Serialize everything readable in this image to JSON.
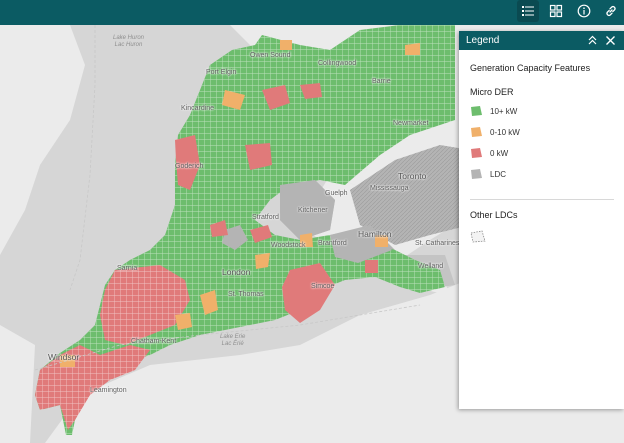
{
  "toolbar": {
    "buttons": [
      {
        "name": "legend-list-icon",
        "active": true
      },
      {
        "name": "basemap-gallery-icon",
        "active": false
      },
      {
        "name": "info-icon",
        "active": false
      },
      {
        "name": "share-link-icon",
        "active": false
      }
    ]
  },
  "legend": {
    "header": "Legend",
    "title": "Generation Capacity Features",
    "layer1": {
      "name": "Micro DER",
      "items": [
        {
          "label": "10+ kW",
          "color": "#6dbd6d"
        },
        {
          "label": "0-10 kW",
          "color": "#f0b06a"
        },
        {
          "label": "0 kW",
          "color": "#e07a7a"
        },
        {
          "label": "LDC",
          "color": "#b4b4b4"
        }
      ]
    },
    "layer2": {
      "name": "Other LDCs"
    }
  },
  "map": {
    "colors": {
      "water": "#d6d6d6",
      "land": "#ebebeb",
      "green": "#6dbd6d",
      "orange": "#f0b06a",
      "red": "#e07a7a",
      "ldc": "#b4b4b4"
    },
    "labels": {
      "lake_huron": "Lake Huron\nLac Huron",
      "lake_erie": "Lake Erie\nLac Érié",
      "port_elgin": "Port Elgin",
      "owen_sound": "Owen Sound",
      "collingwood": "Collingwood",
      "barrie": "Barrie",
      "kincardine": "Kincardine",
      "newmarket": "Newmarket",
      "goderich": "Goderich",
      "toronto": "Toronto",
      "guelph": "Guelph",
      "mississauga": "Mississauga",
      "stratford": "Stratford",
      "kitchener": "Kitchener",
      "woodstock": "Woodstock",
      "brantford": "Brantford",
      "hamilton": "Hamilton",
      "st_catharines": "St. Catharines",
      "sarnia": "Sarnia",
      "london": "London",
      "welland": "Welland",
      "st_thomas": "St. Thomas",
      "simcoe": "Simcoe",
      "chatham_kent": "Chatham-Kent",
      "windsor": "Windsor",
      "leamington": "Leamington"
    }
  }
}
